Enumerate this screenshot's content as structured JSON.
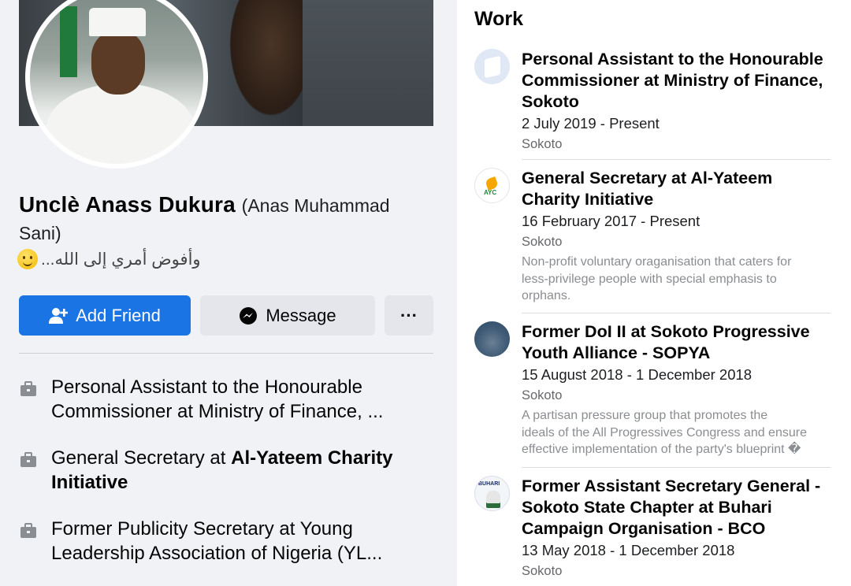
{
  "profile": {
    "name": "Unclè Anass Dukura",
    "alt_name": "(Anas Muhammad Sani)",
    "bio": "وأفوض أمري إلى الله...",
    "bio_emoji": "slightly-smiling-face",
    "cover_icon": "cover-photo",
    "avatar_icon": "profile-photo"
  },
  "actions": {
    "add_friend": "Add Friend",
    "message": "Message",
    "more": "···"
  },
  "intro": {
    "items": [
      {
        "prefix": "Personal Assistant to the Honourable Commissioner at Ministry of Finance, ...",
        "bold": ""
      },
      {
        "prefix": "General Secretary at ",
        "bold": "Al-Yateem Charity Initiative"
      },
      {
        "prefix": "Former Publicity Secretary at Young Leadership Association of Nigeria (YL...",
        "bold": ""
      }
    ],
    "icon": "briefcase-icon"
  },
  "work": {
    "title": "Work",
    "jobs": [
      {
        "title": "Personal Assistant to the Honourable Commissioner at Ministry of Finance, Sokoto",
        "dates": "2 July 2019 - Present",
        "location": "Sokoto",
        "desc": []
      },
      {
        "title": "General Secretary at Al-Yateem Charity Initiative",
        "dates": "16 February 2017 - Present",
        "location": "Sokoto",
        "desc": [
          "Non-profit voluntary oraganisation that caters for",
          "less-privilege people with special emphasis to",
          "orphans."
        ]
      },
      {
        "title": "Former DoI II at Sokoto Progressive Youth Alliance - SOPYA",
        "dates": "15 August 2018 - 1 December 2018",
        "location": "Sokoto",
        "desc": [
          "A partisan pressure group that promotes the",
          "ideals of the All Progressives Congress and ensure",
          "effective implementation of the party's blueprint �"
        ]
      },
      {
        "title": "Former Assistant Secretary General - Sokoto State Chapter at Buhari Campaign Organisation - BCO",
        "dates": "13 May 2018 - 1 December 2018",
        "location": "Sokoto",
        "desc": []
      }
    ]
  },
  "colors": {
    "primary": "#1b74e4",
    "secondary_button": "#e4e6eb",
    "background": "#f0f2f5",
    "muted_text": "#65676b"
  }
}
